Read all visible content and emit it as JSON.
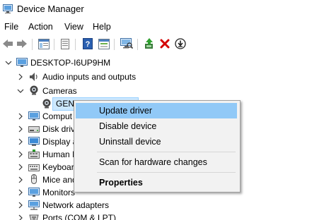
{
  "window": {
    "title": "Device Manager"
  },
  "menu": [
    "File",
    "Action",
    "View",
    "Help"
  ],
  "toolbar": {
    "buttons": [
      "back-icon",
      "forward-icon",
      "show-hide-tree-icon",
      "properties-icon",
      "help-icon",
      "view-icon",
      "scan-hardware-icon",
      "update-driver-icon",
      "uninstall-icon",
      "download-icon"
    ]
  },
  "tree": {
    "root": "DESKTOP-I6UP9HM",
    "items": [
      {
        "label": "Audio inputs and outputs"
      },
      {
        "label": "Cameras"
      },
      {
        "label": "GENERAL WEBCAM"
      },
      {
        "label": "Comput"
      },
      {
        "label": "Disk driv"
      },
      {
        "label": "Display a"
      },
      {
        "label": "Human I"
      },
      {
        "label": "Keyboar"
      },
      {
        "label": "Mice and"
      },
      {
        "label": "Monitors"
      },
      {
        "label": "Network adapters"
      },
      {
        "label": "Ports (COM & LPT)"
      }
    ]
  },
  "context_menu": {
    "items": [
      "Update driver",
      "Disable device",
      "Uninstall device",
      "Scan for hardware changes",
      "Properties"
    ],
    "highlighted": "Update driver"
  },
  "colors": {
    "selection": "#cce8ff",
    "menu_highlight": "#91c9f7",
    "uninstall_x": "#d40000"
  }
}
